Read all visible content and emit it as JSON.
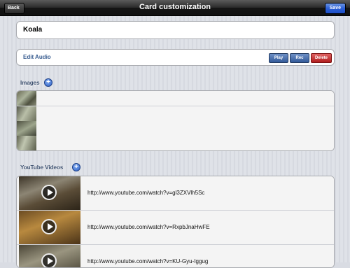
{
  "navbar": {
    "title": "Card customization",
    "back_label": "Back",
    "save_label": "Save"
  },
  "card_name": "Koala",
  "audio": {
    "label": "Edit Audio",
    "play_label": "Play",
    "rec_label": "Rec",
    "delete_label": "Delete"
  },
  "images": {
    "title": "Images",
    "add_icon": "+",
    "count": 4
  },
  "videos": {
    "title": "YouTube Videos",
    "add_icon": "+",
    "items": [
      {
        "url": "http://www.youtube.com/watch?v=gl3ZXVlh5Sc"
      },
      {
        "url": "http://www.youtube.com/watch?v=RxpbJnaHwFE"
      },
      {
        "url": "http://www.youtube.com/watch?v=KU-Gyu-Iggug"
      }
    ]
  }
}
